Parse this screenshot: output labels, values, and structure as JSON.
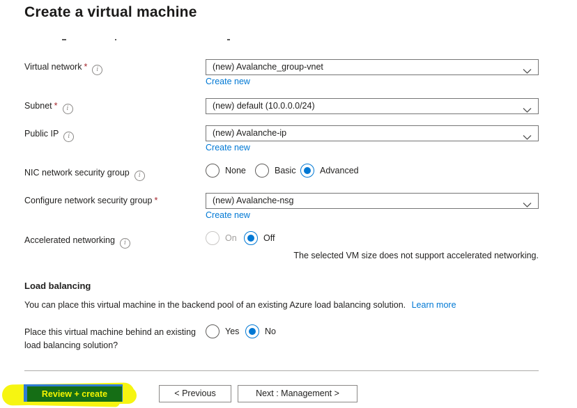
{
  "page": {
    "title": "Create a virtual machine"
  },
  "icons": {
    "info": "i"
  },
  "form": {
    "virtual_network": {
      "label": "Virtual network",
      "required": "*",
      "value": "(new) Avalanche_group-vnet",
      "create_new": "Create new"
    },
    "subnet": {
      "label": "Subnet",
      "required": "*",
      "value": "(new) default (10.0.0.0/24)"
    },
    "public_ip": {
      "label": "Public IP",
      "value": "(new) Avalanche-ip",
      "create_new": "Create new"
    },
    "nic_nsg": {
      "label": "NIC network security group",
      "options": [
        "None",
        "Basic",
        "Advanced"
      ],
      "selected": "Advanced"
    },
    "configure_nsg": {
      "label": "Configure network security group",
      "required": "*",
      "value": "(new) Avalanche-nsg",
      "create_new": "Create new"
    },
    "accelerated_networking": {
      "label": "Accelerated networking",
      "options": [
        "On",
        "Off"
      ],
      "selected": "Off",
      "disabled_option": "On",
      "note": "The selected VM size does not support accelerated networking."
    }
  },
  "load_balancing": {
    "heading": "Load balancing",
    "description": "You can place this virtual machine in the backend pool of an existing Azure load balancing solution.",
    "learn_more": "Learn more",
    "question": {
      "label": "Place this virtual machine behind an existing load balancing solution?",
      "options": [
        "Yes",
        "No"
      ],
      "selected": "No"
    }
  },
  "footer": {
    "review_create_label": "Review + create",
    "previous_label": "< Previous",
    "next_label": "Next : Management >"
  },
  "colors": {
    "accent": "#0078d4",
    "required": "#a4262c",
    "highlight_yellow": "#f6f511",
    "annotated_button_green": "#156e15",
    "annotated_button_blue": "#2f7cd4"
  }
}
